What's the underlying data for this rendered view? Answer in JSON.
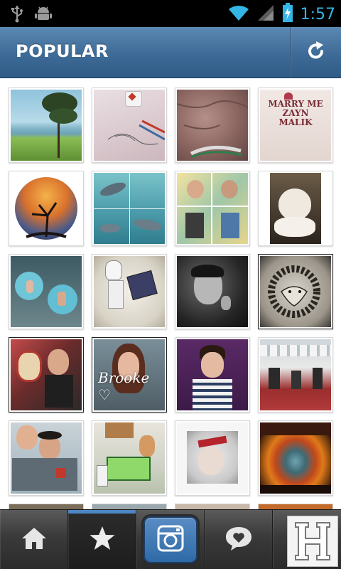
{
  "status_bar": {
    "time": "1:57",
    "icons": [
      "usb-icon",
      "android-debug-icon",
      "wifi-icon",
      "signal-icon",
      "battery-charging-icon"
    ]
  },
  "header": {
    "title": "POPULAR",
    "refresh_icon": "refresh-icon"
  },
  "grid": {
    "photos": [
      {
        "name": "tree-by-sea"
      },
      {
        "name": "sketch-with-pencils"
      },
      {
        "name": "elephant-closeup"
      },
      {
        "name": "marry-me-zayn-malik-shirt",
        "caption": "MARRY ME\nZAYN\nMALIK"
      },
      {
        "name": "fisheye-sunset-tree"
      },
      {
        "name": "dolphins-collage"
      },
      {
        "name": "glasses-collage"
      },
      {
        "name": "cat-on-pillow"
      },
      {
        "name": "beanbags-aerial"
      },
      {
        "name": "stormtrooper-toy"
      },
      {
        "name": "man-portrait-bw"
      },
      {
        "name": "lion-drawing"
      },
      {
        "name": "wrestling-mask-photo"
      },
      {
        "name": "brooke-portrait",
        "script": "Brooke ♡"
      },
      {
        "name": "striped-shirt-portrait"
      },
      {
        "name": "gym-interior"
      },
      {
        "name": "couple-hug"
      },
      {
        "name": "toy-figures-scene"
      },
      {
        "name": "red-bandana-photo"
      },
      {
        "name": "sunset-clouds"
      }
    ]
  },
  "tabbar": {
    "tabs": [
      {
        "name": "home",
        "icon": "home-icon"
      },
      {
        "name": "popular",
        "icon": "star-icon",
        "active": true
      },
      {
        "name": "camera",
        "icon": "camera-icon"
      },
      {
        "name": "news",
        "icon": "heart-bubble-icon"
      },
      {
        "name": "profile",
        "icon": "h-logo-icon"
      }
    ]
  },
  "colors": {
    "header": "#3d6a96",
    "status_accent": "#33b5e5",
    "active_tab": "#4c86c4"
  }
}
